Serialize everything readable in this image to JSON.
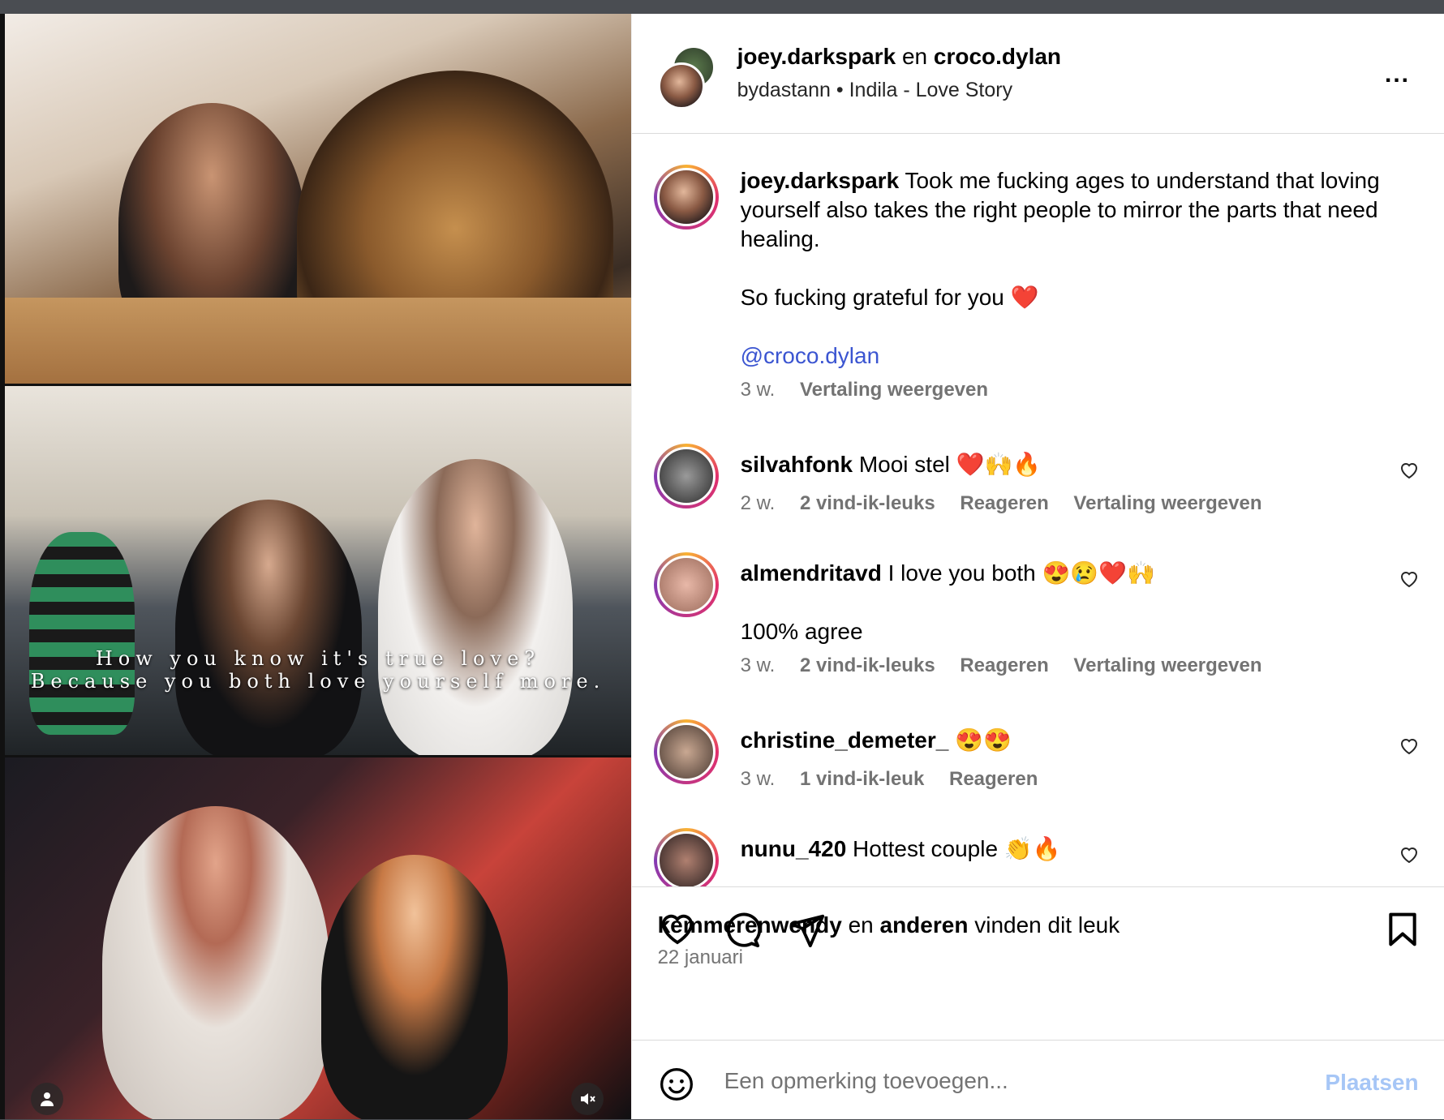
{
  "media": {
    "overlay_line1": "How you know it's true love?",
    "overlay_line2": "Because you both love yourself more."
  },
  "header": {
    "user1": "joey.darkspark",
    "joiner": "en",
    "user2": "croco.dylan",
    "audio_author": "bydastann",
    "separator": "•",
    "audio_track": "Indila - Love Story",
    "more": "..."
  },
  "caption": {
    "username": "joey.darkspark",
    "text": "Took me fucking ages to understand that loving yourself also takes the right people to mirror the parts that need healing.",
    "line2": "So fucking grateful for you ❤️",
    "mention": "@croco.dylan",
    "time": "3 w.",
    "translate": "Vertaling weergeven"
  },
  "comments": [
    {
      "username": "silvahfonk",
      "text": "Mooi stel ❤️🙌🔥",
      "time": "2 w.",
      "likes": "2 vind-ik-leuks",
      "reply": "Reageren",
      "translate": "Vertaling weergeven"
    },
    {
      "username": "almendritavd",
      "text": "I love you both 😍😢❤️🙌",
      "extra": "100% agree",
      "time": "3 w.",
      "likes": "2 vind-ik-leuks",
      "reply": "Reageren",
      "translate": "Vertaling weergeven"
    },
    {
      "username": "christine_demeter_",
      "text": "😍😍",
      "time": "3 w.",
      "likes": "1 vind-ik-leuk",
      "reply": "Reageren"
    },
    {
      "username": "nunu_420",
      "text": "Hottest couple 👏🔥"
    }
  ],
  "icons": {
    "like": "heart-icon",
    "comment": "comment-icon",
    "share": "share-icon",
    "save": "bookmark-icon",
    "emoji": "emoji-icon"
  },
  "likes": {
    "user": "kemmerenwendy",
    "mid": "en",
    "others": "anderen",
    "suffix": "vinden dit leuk"
  },
  "date": "22 januari",
  "comment_box": {
    "placeholder": "Een opmerking toevoegen...",
    "post": "Plaatsen"
  },
  "colors": {
    "mention": "#3b55d1",
    "post_button": "#a6c6f6",
    "meta_text": "#737373"
  }
}
